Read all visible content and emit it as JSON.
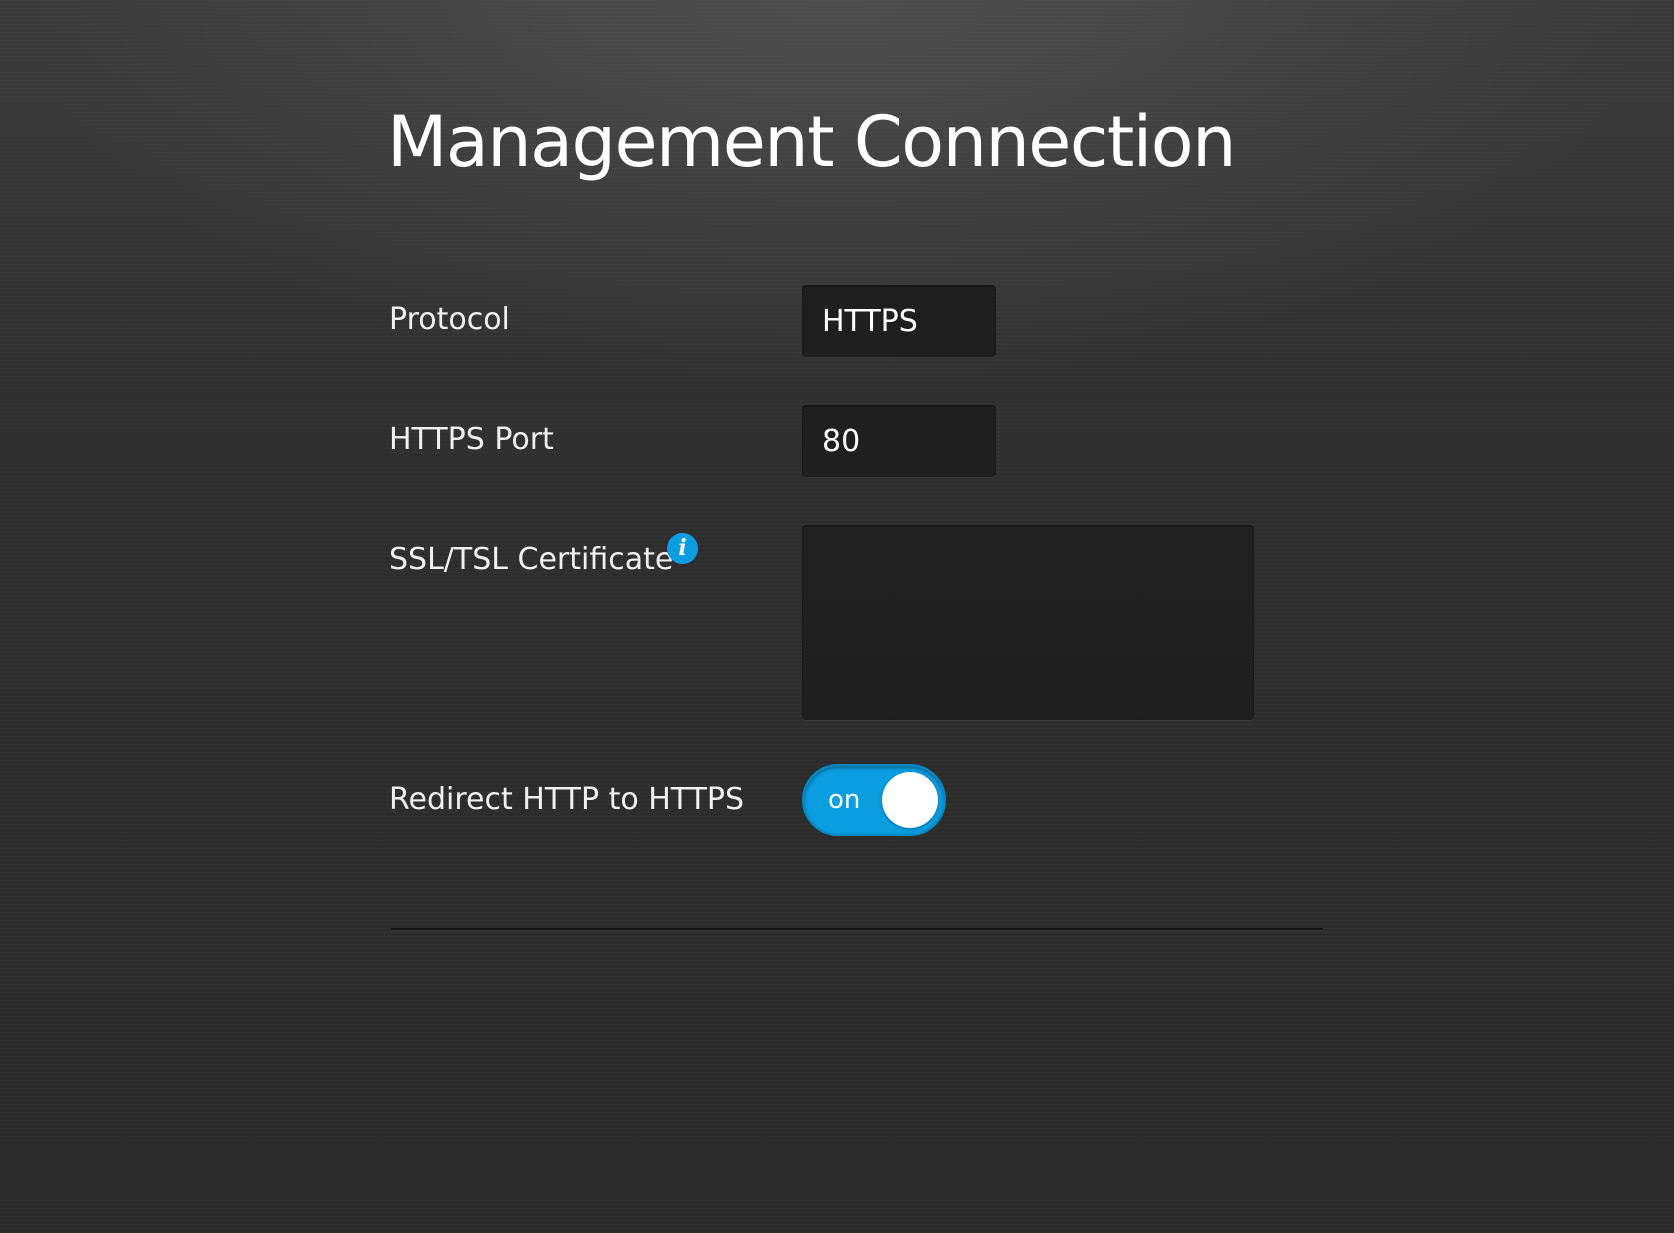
{
  "page": {
    "title": "Management Connection"
  },
  "form": {
    "protocol": {
      "label": "Protocol",
      "value": "HTTPS"
    },
    "https_port": {
      "label": "HTTPS Port",
      "value": "80"
    },
    "ssl_certificate": {
      "label": "SSL/TSL Certificate",
      "info_icon_text": "i",
      "value": ""
    },
    "redirect_http_to_https": {
      "label": "Redirect HTTP to HTTPS",
      "state_text": "on",
      "enabled": true
    }
  },
  "colors": {
    "accent": "#0a9de0",
    "field_background": "#1f1f1f",
    "text": "#f0f0f0"
  },
  "icons": {
    "info": "info-icon"
  }
}
